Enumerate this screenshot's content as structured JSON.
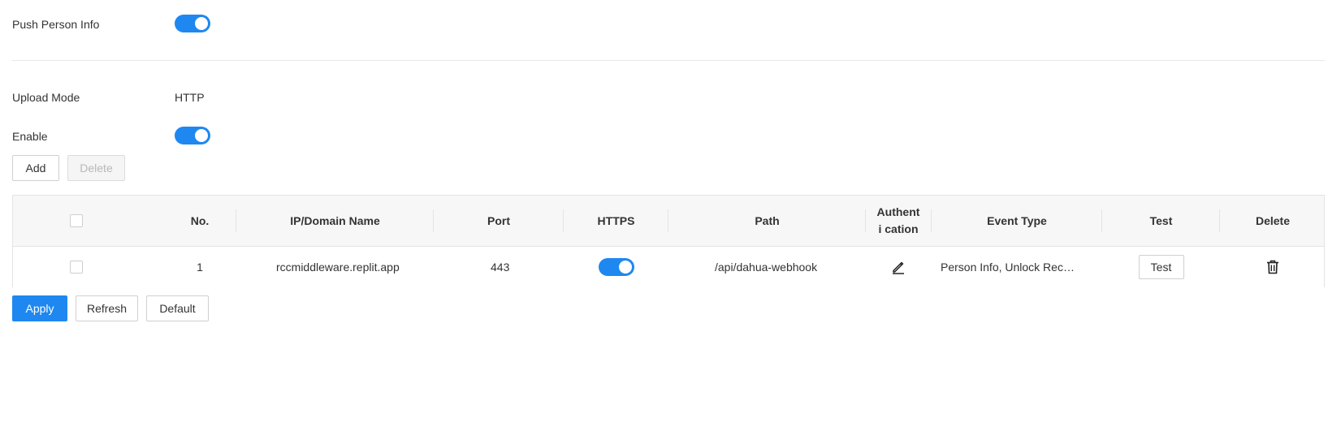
{
  "push_person_info": {
    "label": "Push Person Info",
    "enabled": true
  },
  "upload_mode": {
    "label": "Upload Mode",
    "value": "HTTP"
  },
  "enable": {
    "label": "Enable",
    "enabled": true
  },
  "toolbar": {
    "add_label": "Add",
    "delete_label": "Delete"
  },
  "table": {
    "headers": {
      "no": "No.",
      "ip_domain": "IP/Domain Name",
      "port": "Port",
      "https": "HTTPS",
      "path": "Path",
      "authentication": "Authenti cation",
      "event_type": "Event Type",
      "test": "Test",
      "delete": "Delete"
    },
    "rows": [
      {
        "checked": false,
        "no": "1",
        "ip_domain": "rccmiddleware.replit.app",
        "port": "443",
        "https": true,
        "path": "/api/dahua-webhook",
        "auth_icon": "edit-icon",
        "event_type": "Person Info, Unlock Reco...",
        "test_label": "Test",
        "delete_icon": "trash-icon"
      }
    ]
  },
  "footer": {
    "apply_label": "Apply",
    "refresh_label": "Refresh",
    "default_label": "Default"
  },
  "colors": {
    "accent": "#1e88f0",
    "border": "#e4e4e4",
    "header_bg": "#f7f7f7"
  }
}
